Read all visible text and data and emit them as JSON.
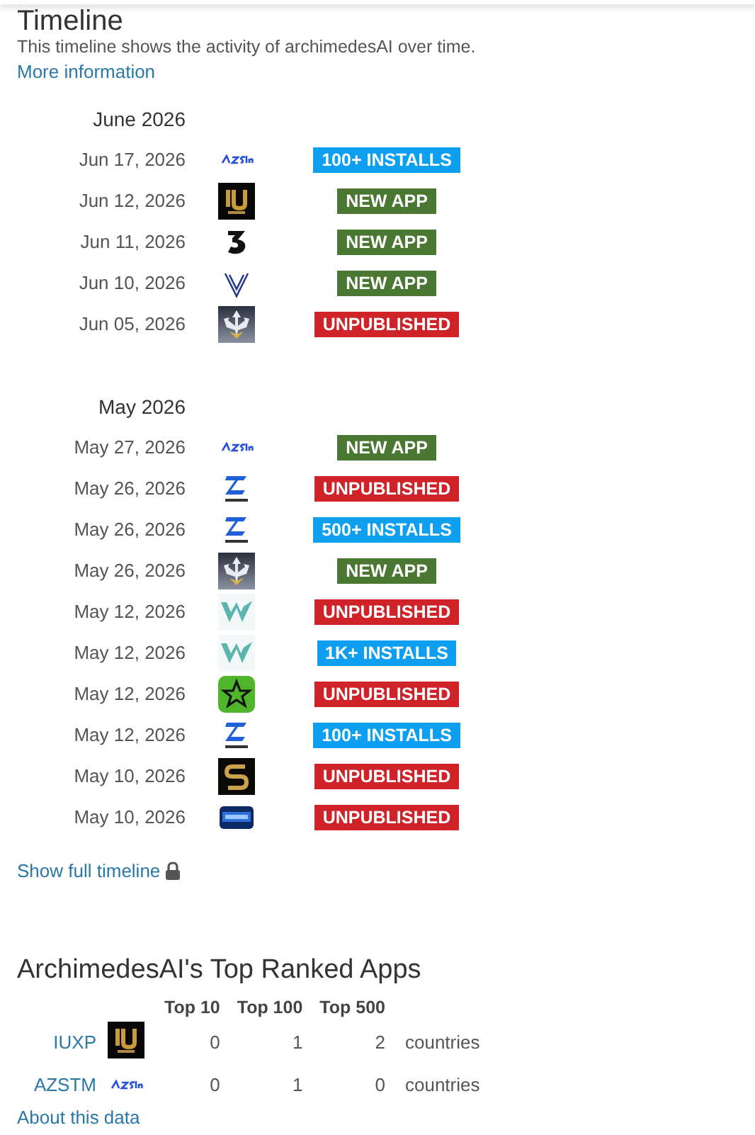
{
  "timeline": {
    "title": "Timeline",
    "description": "This timeline shows the activity of archimedesAI over time.",
    "more_link": "More information",
    "months": [
      {
        "label": "June 2026",
        "events": [
          {
            "date": "Jun 17, 2026",
            "logo": {
              "kind": "azstm"
            },
            "kind": "installs",
            "badge": "100+ INSTALLS"
          },
          {
            "date": "Jun 12, 2026",
            "logo": {
              "kind": "iuxp"
            },
            "kind": "new",
            "badge": "NEW APP"
          },
          {
            "date": "Jun 11, 2026",
            "logo": {
              "kind": "three"
            },
            "kind": "new",
            "badge": "NEW APP"
          },
          {
            "date": "Jun 10, 2026",
            "logo": {
              "kind": "vee"
            },
            "kind": "new",
            "badge": "NEW APP"
          },
          {
            "date": "Jun 05, 2026",
            "logo": {
              "kind": "shield"
            },
            "kind": "unpublished",
            "badge": "UNPUBLISHED"
          }
        ]
      },
      {
        "label": "May 2026",
        "events": [
          {
            "date": "May 27, 2026",
            "logo": {
              "kind": "azstm"
            },
            "kind": "new",
            "badge": "NEW APP"
          },
          {
            "date": "May 26, 2026",
            "logo": {
              "kind": "teelx"
            },
            "kind": "unpublished",
            "badge": "UNPUBLISHED"
          },
          {
            "date": "May 26, 2026",
            "logo": {
              "kind": "teelx"
            },
            "kind": "installs",
            "badge": "500+ INSTALLS"
          },
          {
            "date": "May 26, 2026",
            "logo": {
              "kind": "shield"
            },
            "kind": "new",
            "badge": "NEW APP"
          },
          {
            "date": "May 12, 2026",
            "logo": {
              "kind": "w"
            },
            "kind": "unpublished",
            "badge": "UNPUBLISHED"
          },
          {
            "date": "May 12, 2026",
            "logo": {
              "kind": "w"
            },
            "kind": "installs",
            "badge": "1K+ INSTALLS"
          },
          {
            "date": "May 12, 2026",
            "logo": {
              "kind": "star"
            },
            "kind": "unpublished",
            "badge": "UNPUBLISHED"
          },
          {
            "date": "May 12, 2026",
            "logo": {
              "kind": "teelx"
            },
            "kind": "installs",
            "badge": "100+ INSTALLS"
          },
          {
            "date": "May 10, 2026",
            "logo": {
              "kind": "s"
            },
            "kind": "unpublished",
            "badge": "UNPUBLISHED"
          },
          {
            "date": "May 10, 2026",
            "logo": {
              "kind": "tv"
            },
            "kind": "unpublished",
            "badge": "UNPUBLISHED"
          }
        ]
      }
    ],
    "full_link": "Show full timeline"
  },
  "top_ranked": {
    "title": "ArchimedesAI's Top Ranked Apps",
    "columns": [
      "Top 10",
      "Top 100",
      "Top 500"
    ],
    "rows": [
      {
        "name": "IUXP",
        "logo": {
          "kind": "iuxp"
        },
        "values": [
          "0",
          "1",
          "2"
        ],
        "unit": "countries"
      },
      {
        "name": "AZSTM",
        "logo": {
          "kind": "azstm"
        },
        "values": [
          "0",
          "1",
          "0"
        ],
        "unit": "countries"
      }
    ],
    "about_link": "About this data"
  }
}
